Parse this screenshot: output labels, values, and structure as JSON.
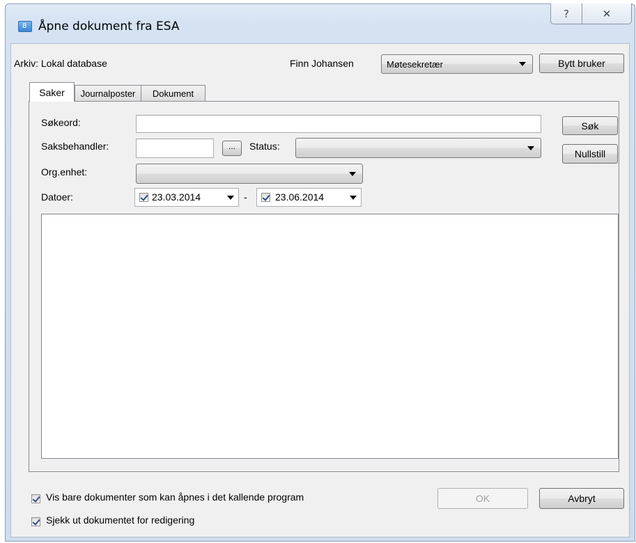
{
  "window": {
    "title": "Åpne dokument fra ESA",
    "app_icon_label": "8",
    "help_glyph": "?",
    "close_glyph": "✕"
  },
  "header": {
    "archive_label": "Arkiv: Lokal database",
    "user_name": "Finn Johansen",
    "role_selected": "Møtesekretær",
    "switch_user_label": "Bytt bruker"
  },
  "tabs": [
    {
      "label": "Saker",
      "active": true
    },
    {
      "label": "Journalposter",
      "active": false
    },
    {
      "label": "Dokument",
      "active": false
    }
  ],
  "search_form": {
    "keyword_label": "Søkeord:",
    "keyword_value": "",
    "handler_label": "Saksbehandler:",
    "handler_value": "",
    "browse_label": "...",
    "status_label": "Status:",
    "status_value": "",
    "org_label": "Org.enhet:",
    "org_value": "",
    "dates_label": "Datoer:",
    "date_from": "23.03.2014",
    "date_from_checked": true,
    "date_separator": "-",
    "date_to": "23.06.2014",
    "date_to_checked": true,
    "search_button": "Søk",
    "reset_button": "Nullstill"
  },
  "results": [],
  "footer": {
    "option_only_openable": "Vis bare dokumenter som kan åpnes i det kallende program",
    "option_only_openable_checked": true,
    "option_checkout": "Sjekk ut dokumentet for redigering",
    "option_checkout_checked": true,
    "ok_button": "OK",
    "ok_enabled": false,
    "cancel_button": "Avbryt"
  }
}
